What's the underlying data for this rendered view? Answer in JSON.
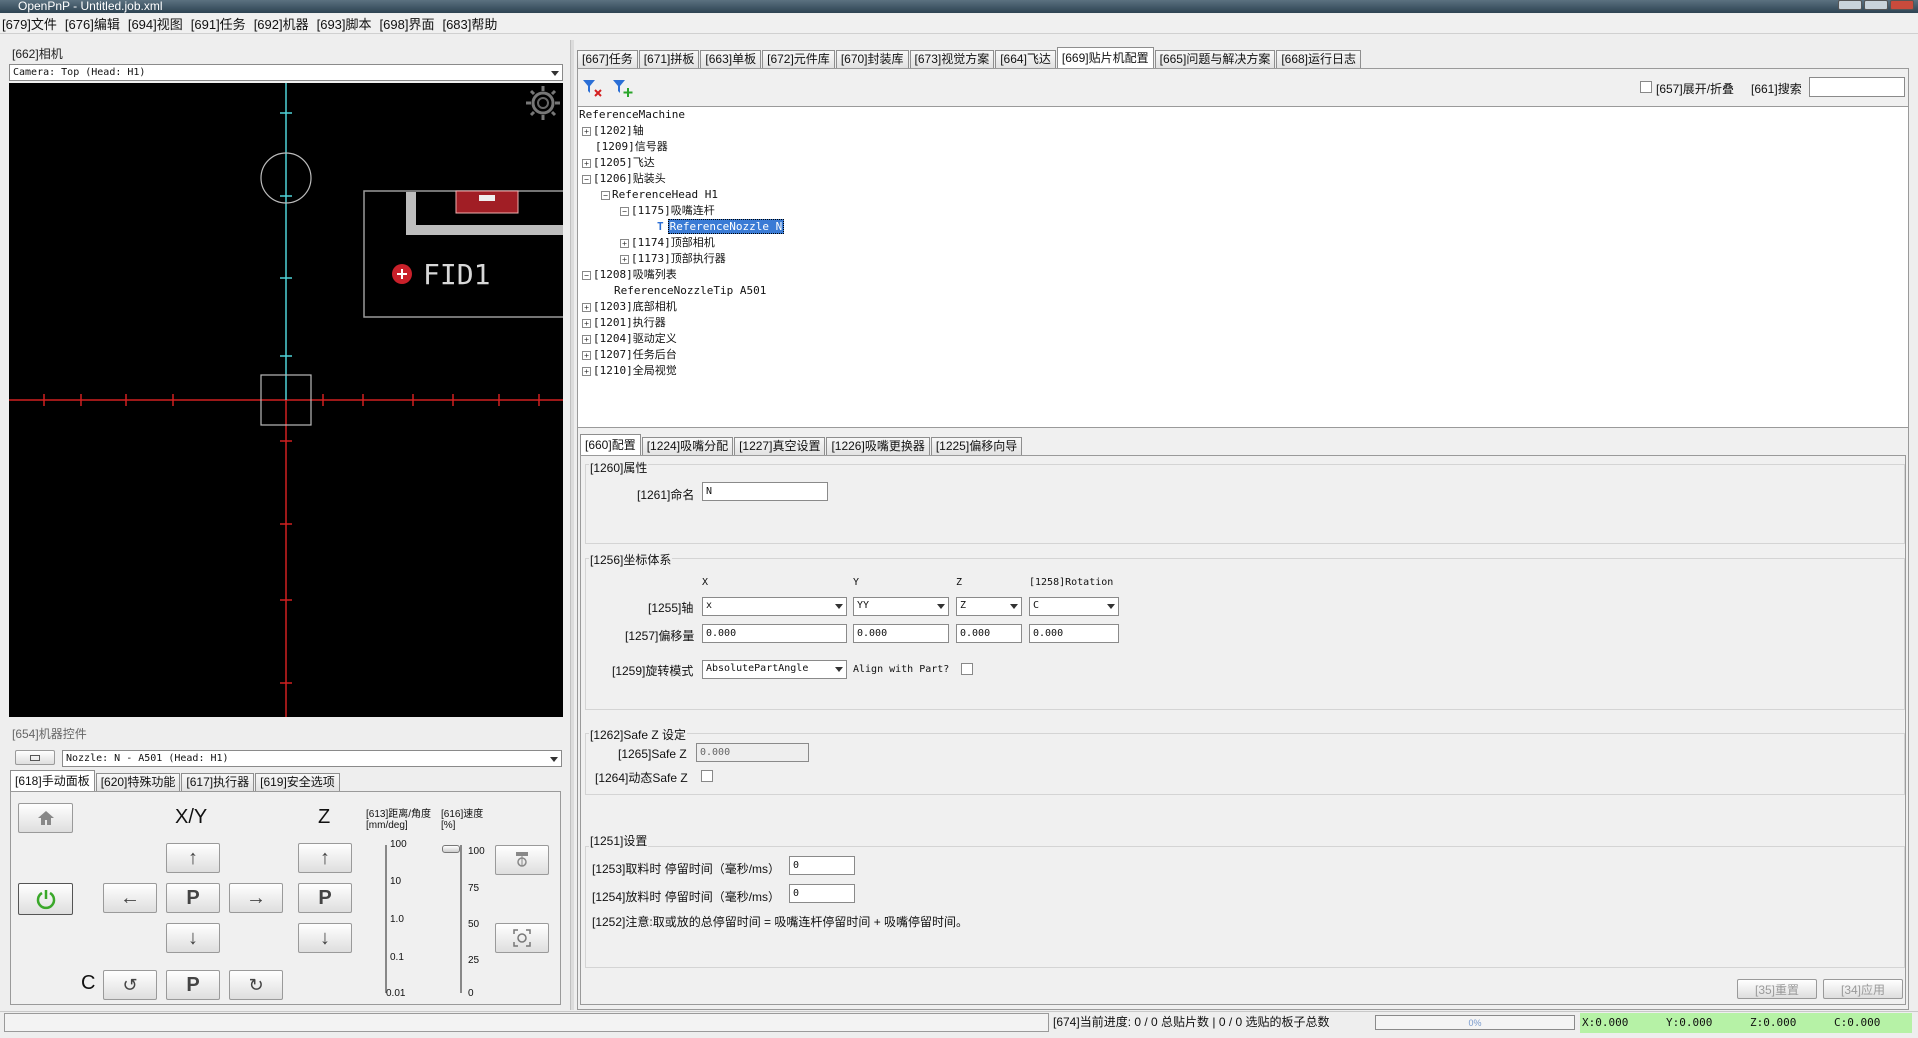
{
  "window": {
    "title": "OpenPnP - Untitled.job.xml"
  },
  "menu": [
    "[679]文件",
    "[676]编辑",
    "[694]视图",
    "[691]任务",
    "[692]机器",
    "[693]脚本",
    "[698]界面",
    "[683]帮助"
  ],
  "camera": {
    "panel_label": "[662]相机",
    "selected": "Camera: Top (Head: H1)",
    "fiducial_label": "FID1"
  },
  "machine_controls": {
    "panel_label": "[654]机器控件",
    "nozzle_selected": "Nozzle: N - A501 (Head: H1)",
    "tabs": [
      "[618]手动面板",
      "[620]特殊功能",
      "[617]执行器",
      "[619]安全选项"
    ],
    "xy_label": "X/Y",
    "z_label": "Z",
    "c_label": "C",
    "park_label": "P",
    "distance_label": "[613]距离/角度",
    "distance_unit": "[mm/deg]",
    "speed_label": "[616]速度",
    "speed_unit": "[%]",
    "distance_ticks": [
      "100",
      "10",
      "1.0",
      "0.1",
      "0.01"
    ],
    "speed_ticks": [
      "100",
      "75",
      "50",
      "25",
      "0"
    ],
    "speed_value": 100
  },
  "top_tabs": [
    "[667]任务",
    "[671]拼板",
    "[663]单板",
    "[672]元件库",
    "[670]封装库",
    "[673]视觉方案",
    "[664]飞达",
    "[669]贴片机配置",
    "[665]问题与解决方案",
    "[668]运行日志"
  ],
  "toolbar": {
    "expand_label": "[657]展开/折叠",
    "search_label": "[661]搜索",
    "search_value": ""
  },
  "tree": {
    "root": "ReferenceMachine",
    "axis": "[1202]轴",
    "signal": "[1209]信号器",
    "feeders": "[1205]飞达",
    "heads": "[1206]贴装头",
    "head": "ReferenceHead H1",
    "nozzles_group": "[1175]吸嘴连杆",
    "nozzle": "ReferenceNozzle N",
    "top_cameras": "[1174]顶部相机",
    "head_actuators": "[1173]顶部执行器",
    "nozzle_tips": "[1208]吸嘴列表",
    "nozzle_tip": "ReferenceNozzleTip A501",
    "bottom_cameras": "[1203]底部相机",
    "actuators": "[1201]执行器",
    "drivers": "[1204]驱动定义",
    "job_processors": "[1207]任务后台",
    "global_vision": "[1210]全局视觉"
  },
  "config_tabs": [
    "[660]配置",
    "[1224]吸嘴分配",
    "[1227]真空设置",
    "[1226]吸嘴更换器",
    "[1225]偏移向导"
  ],
  "properties": {
    "section": "[1260]属性",
    "name_label": "[1261]命名",
    "name_value": "N"
  },
  "coords": {
    "section": "[1256]坐标体系",
    "col_x": "X",
    "col_y": "Y",
    "col_z": "Z",
    "col_rot": "[1258]Rotation",
    "axis_label": "[1255]轴",
    "axis_x": "x",
    "axis_y": "YY",
    "axis_z": "Z",
    "axis_c": "C",
    "offset_label": "[1257]偏移量",
    "offset_x": "0.000",
    "offset_y": "0.000",
    "offset_z": "0.000",
    "offset_rot": "0.000",
    "rot_mode_label": "[1259]旋转模式",
    "rot_mode": "AbsolutePartAngle",
    "align_label": "Align with Part?"
  },
  "safez": {
    "section": "[1262]Safe Z 设定",
    "safe_z_label": "[1265]Safe Z",
    "safe_z_value": "0.000",
    "dynamic_label": "[1264]动态Safe Z"
  },
  "settings": {
    "section": "[1251]设置",
    "pick_label": "[1253]取料时 停留时间（毫秒/ms）",
    "pick_value": "0",
    "place_label": "[1254]放料时 停留时间（毫秒/ms）",
    "place_value": "0",
    "note": "[1252]注意:取或放的总停留时间 = 吸嘴连杆停留时间 + 吸嘴停留时间。"
  },
  "buttons": {
    "reset": "[35]重置",
    "apply": "[34]应用"
  },
  "status": {
    "progress_text": "[674]当前进度: 0 / 0 总贴片数 | 0 / 0 选贴的板子总数",
    "progress_percent": "0%",
    "progress_value": 0,
    "x": "X:0.000",
    "y": "Y:0.000",
    "z": "Z:0.000",
    "c": "C:0.000",
    "position_bg": "#b6f2a6"
  }
}
